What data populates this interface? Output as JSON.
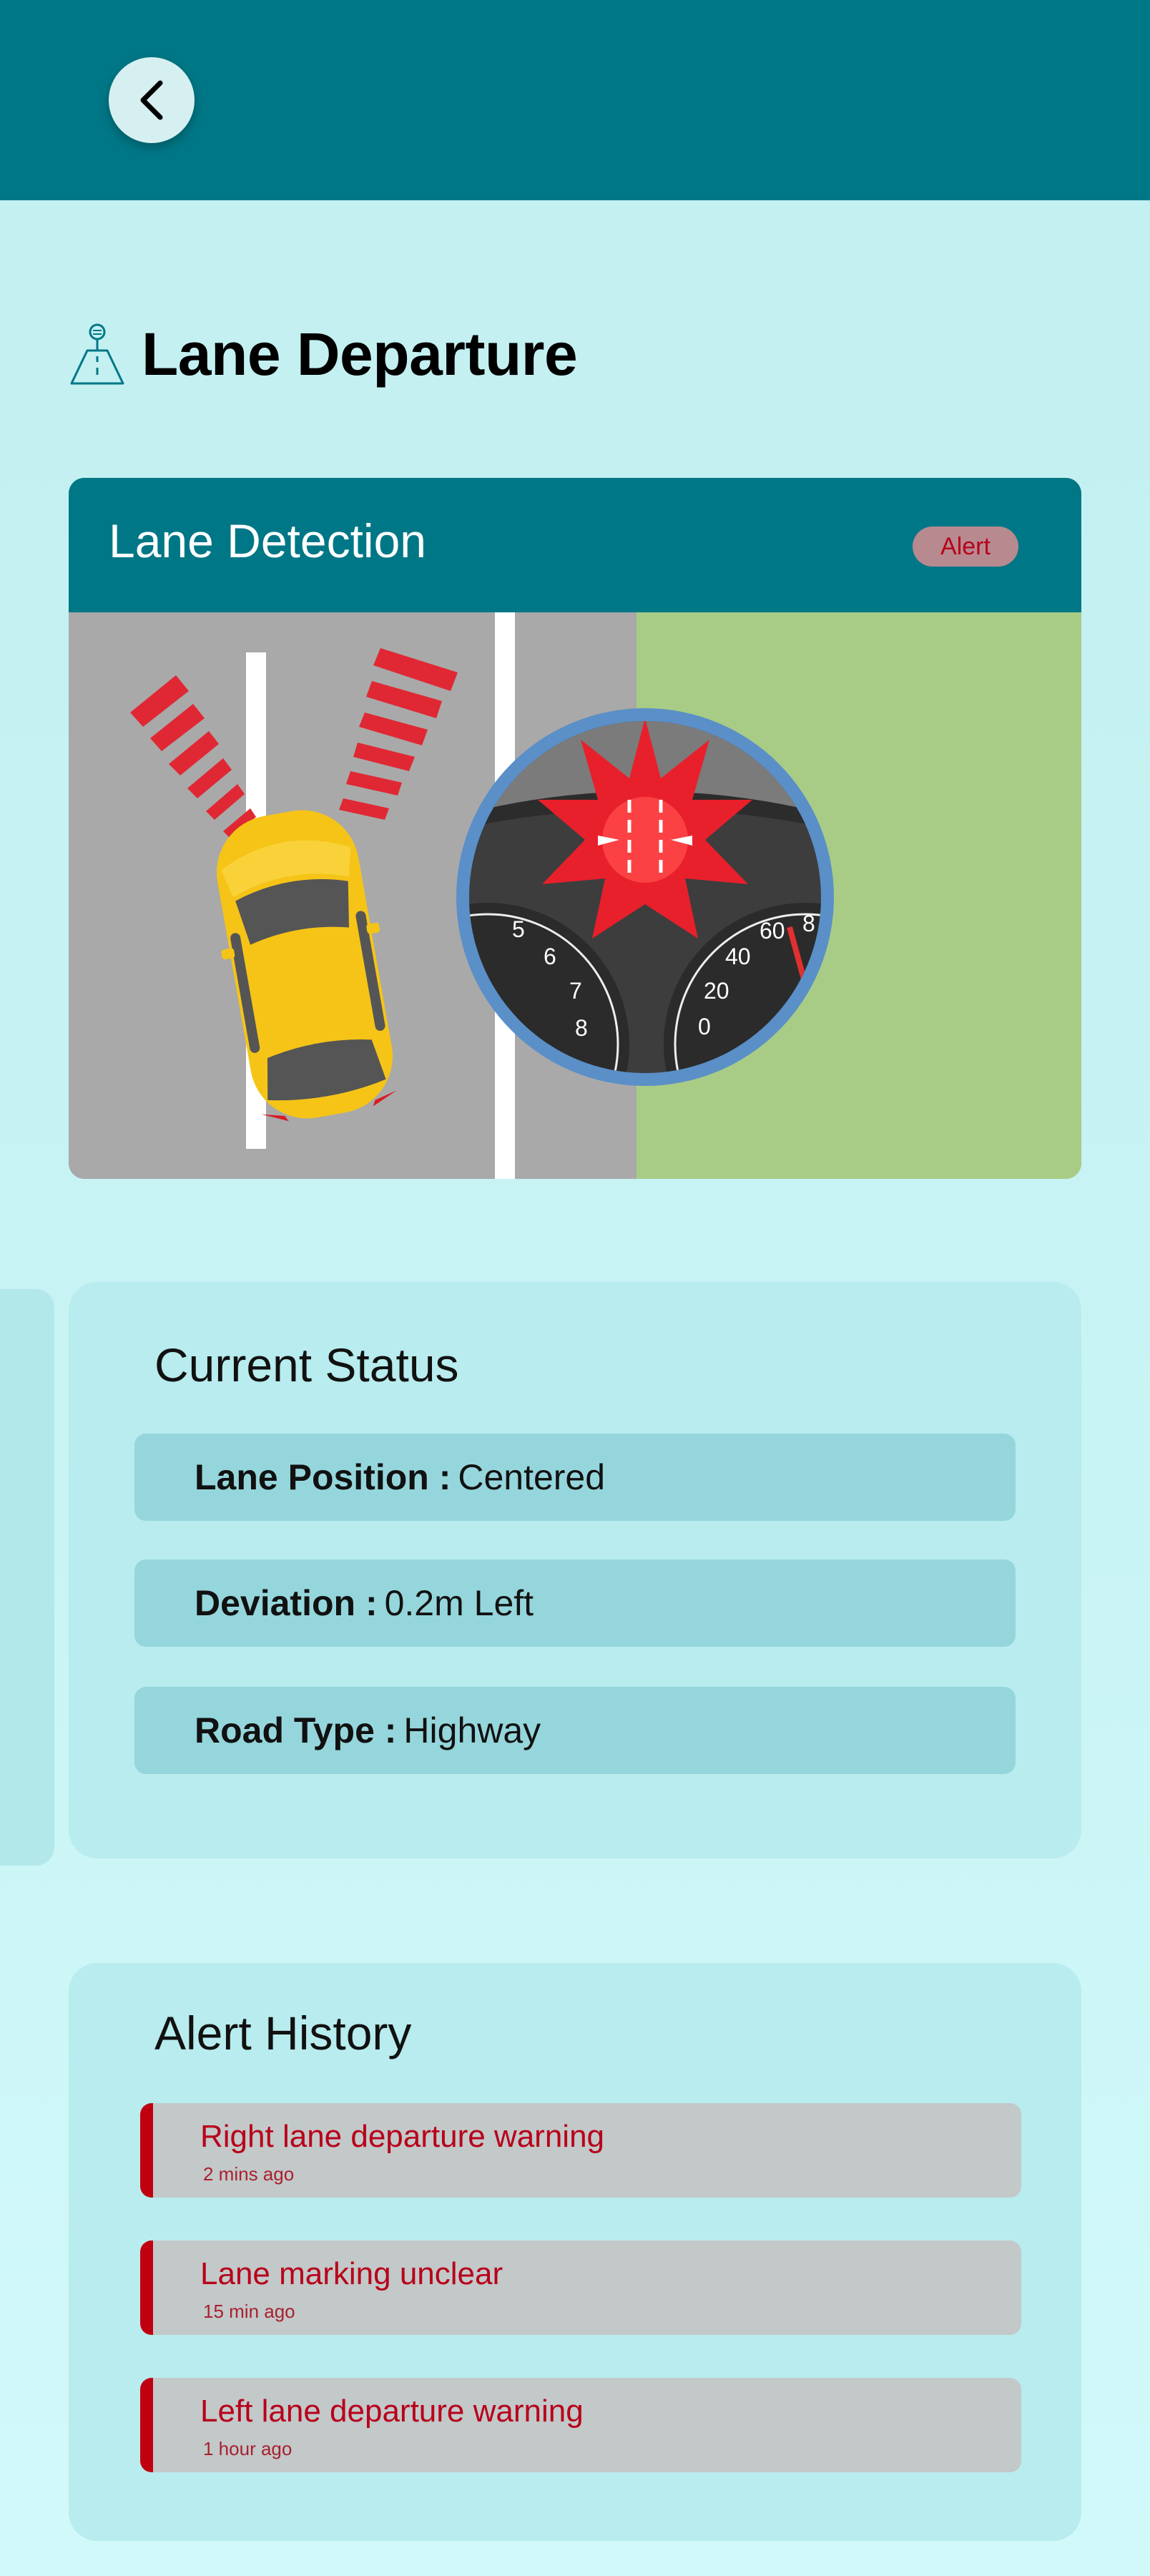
{
  "header": {
    "back_icon": "chevron-left-icon"
  },
  "page": {
    "title": "Lane Departure",
    "title_icon": "road-sign-icon"
  },
  "lane_detection": {
    "title": "Lane Detection",
    "badge": "Alert",
    "gauge_left_ticks": [
      "5",
      "6",
      "7",
      "8"
    ],
    "gauge_right_ticks": [
      "0",
      "20",
      "40",
      "60",
      "8"
    ]
  },
  "current_status": {
    "heading": "Current Status",
    "rows": [
      {
        "key": "Lane Position :",
        "value": "Centered"
      },
      {
        "key": "Deviation :",
        "value": "0.2m Left"
      },
      {
        "key": "Road Type :",
        "value": "Highway"
      }
    ]
  },
  "alert_history": {
    "heading": "Alert History",
    "items": [
      {
        "title": "Right lane departure warning",
        "time": "2 mins ago"
      },
      {
        "title": "Lane marking unclear",
        "time": "15 min ago"
      },
      {
        "title": "Left lane departure warning",
        "time": "1 hour ago"
      }
    ]
  },
  "colors": {
    "primary": "#007786",
    "background": "#c2eff0",
    "alert_red": "#c00010",
    "status_row": "#95d6dc"
  }
}
